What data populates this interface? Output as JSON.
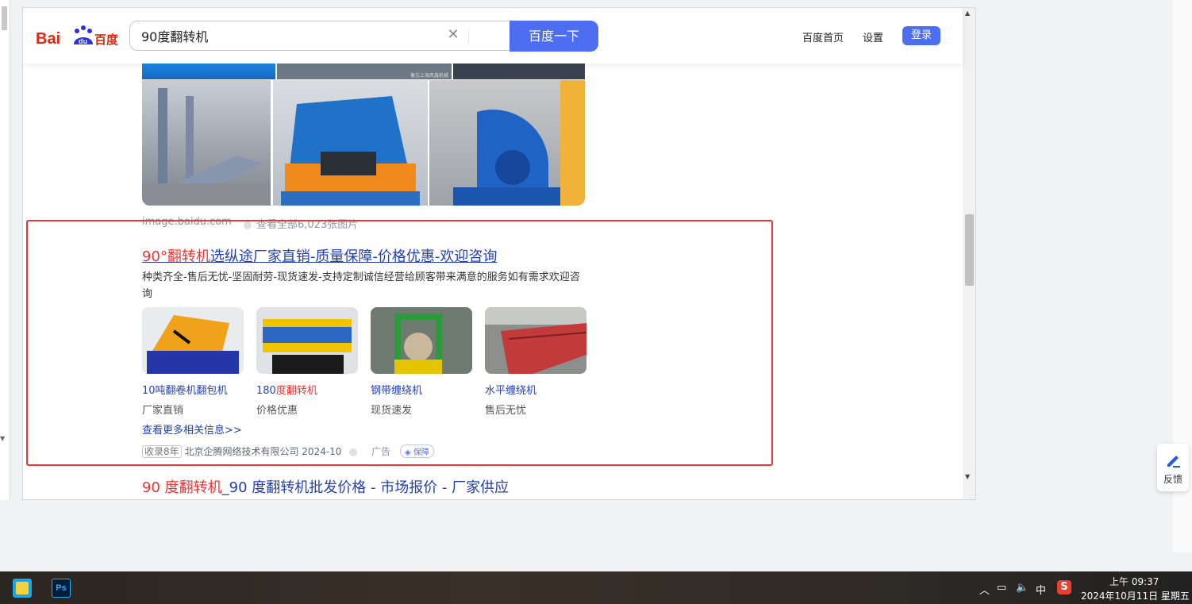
{
  "header": {
    "search_query": "90度翻转机",
    "search_button": "百度一下",
    "links": [
      "百度首页",
      "设置"
    ],
    "login": "登录"
  },
  "image_results": {
    "source": "image.baidu.com",
    "more": "查看全部6,023张图片",
    "watermark": "备忘上海风鑫机械"
  },
  "ad": {
    "title_highlight": "90°翻转机",
    "title_rest": "选纵途厂家直销-质量保障-价格优惠-欢迎咨询",
    "description": "种类齐全-售后无忧-坚固耐劳-现货速发-支持定制诚信经营给顾客带来满意的服务如有需求欢迎咨询",
    "products": [
      {
        "name": "10吨翻卷机翻包机",
        "name_hl": "",
        "sub": "厂家直销"
      },
      {
        "name": "180",
        "name_hl": "度翻转机",
        "sub": "价格优惠"
      },
      {
        "name": "钢带缠绕机",
        "name_hl": "",
        "sub": "现货速发"
      },
      {
        "name": "水平缠绕机",
        "name_hl": "",
        "sub": "售后无忧"
      }
    ],
    "more_link": "查看更多相关信息>>",
    "years_badge": "收录8年",
    "company": "北京企腾网络技术有限公司 2024-10",
    "ad_label": "广告",
    "guarantee": "保障"
  },
  "next_result": {
    "title_hl": "90 度翻转机",
    "title_rest": "_90 度翻转机批发价格 - 市场报价 - 厂家供应"
  },
  "feedback": "反馈",
  "taskbar": {
    "ime": "中",
    "time": "上午 09:37",
    "date": "2024年10月11日 星期五"
  }
}
